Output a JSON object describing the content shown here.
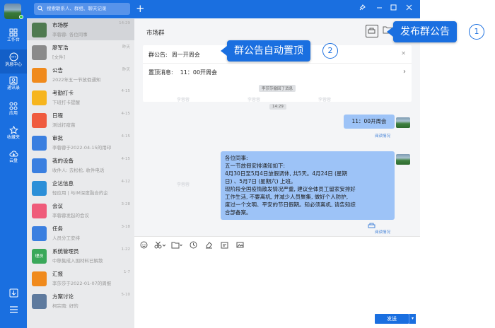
{
  "search": {
    "placeholder": "搜索联系人、群组、聊天记录"
  },
  "rail": [
    {
      "label": "工作台",
      "icon": "grid-icon"
    },
    {
      "label": "消息中心",
      "icon": "message-icon"
    },
    {
      "label": "通讯录",
      "icon": "contacts-icon"
    },
    {
      "label": "应用",
      "icon": "apps-icon"
    },
    {
      "label": "收藏夹",
      "icon": "star-icon"
    },
    {
      "label": "云盘",
      "icon": "cloud-icon"
    }
  ],
  "conversations": [
    {
      "name": "市场群",
      "sub": "李蓉蓉: 各位同事",
      "time": "14:29",
      "color": "#4f7a50"
    },
    {
      "name": "廖军浩",
      "sub": "[文件]",
      "time": "昨天",
      "color": "#8a8a8a"
    },
    {
      "name": "公告",
      "sub": "2022年五一节放假通知",
      "time": "昨天",
      "color": "#f08a1c"
    },
    {
      "name": "考勤打卡",
      "sub": "下班打卡提醒",
      "time": "4-15",
      "color": "#f6b51e"
    },
    {
      "name": "日程",
      "sub": "测试打疫苗",
      "time": "4-15",
      "color": "#ef5b3f"
    },
    {
      "name": "审批",
      "sub": "李蓉蓉于2022-04-15的用印",
      "time": "4-15",
      "color": "#3a7fe0"
    },
    {
      "name": "我的设备",
      "sub": "收件人: 去松松, 收件电话",
      "time": "4-15",
      "color": "#3a7fe0"
    },
    {
      "name": "企达信息",
      "sub": "轻应用 | 与IM深度融合的企",
      "time": "4-12",
      "color": "#2b8fd8"
    },
    {
      "name": "会议",
      "sub": "李蓉蓉发起的会议",
      "time": "3-28",
      "color": "#ef5b7a"
    },
    {
      "name": "任务",
      "sub": "人员分工安排",
      "time": "3-18",
      "color": "#3a7fe0"
    },
    {
      "name": "系统管理员",
      "sub": "中移集成入围材料已解散",
      "time": "1-22",
      "color": "#3aa85a",
      "tag": "理员"
    },
    {
      "name": "汇报",
      "sub": "李莎莎于2022-01-07的周报",
      "time": "1-7",
      "color": "#f08a1c"
    },
    {
      "name": "方案讨论",
      "sub": "柯宗南: 好的",
      "time": "5-10",
      "color": "#5e7a9e"
    }
  ],
  "chat": {
    "title": "市场群",
    "notice_label": "群公告:",
    "notice_value": "周一开周会",
    "pinned_label": "置顶消息:",
    "pinned_value": "11：00开周会",
    "sys1": "李莎莎撤回了消息",
    "sys2": "14:29",
    "msg1": "11：00开周会",
    "read1": "阅读情况",
    "msg2_lines": [
      "各位同事:",
      "五一节放假安排通知如下:",
      "4月30日至5月4日放假调休, 共5天。4月24日 (星期",
      "日) 、5月7日 (星期六) 上班。",
      "现阶段全国疫情散发情况严重, 建议全体员工留家安排好",
      "工作生活, 不要离机, 并减少人员聚集, 做好个人防护,",
      "度过一个文明、平安的节日假期。知必须离机, 请告知综",
      "合部备案。"
    ],
    "read2": "阅读情况",
    "send": "发送",
    "watermark": "李蓉蓉"
  },
  "callouts": {
    "c1": "发布群公告",
    "n1": "1",
    "c2": "群公告自动置顶",
    "n2": "2"
  },
  "colors": {
    "brand": "#1a6fe0",
    "bubble": "#9dc3f7",
    "list_bg": "#e9eaec"
  }
}
